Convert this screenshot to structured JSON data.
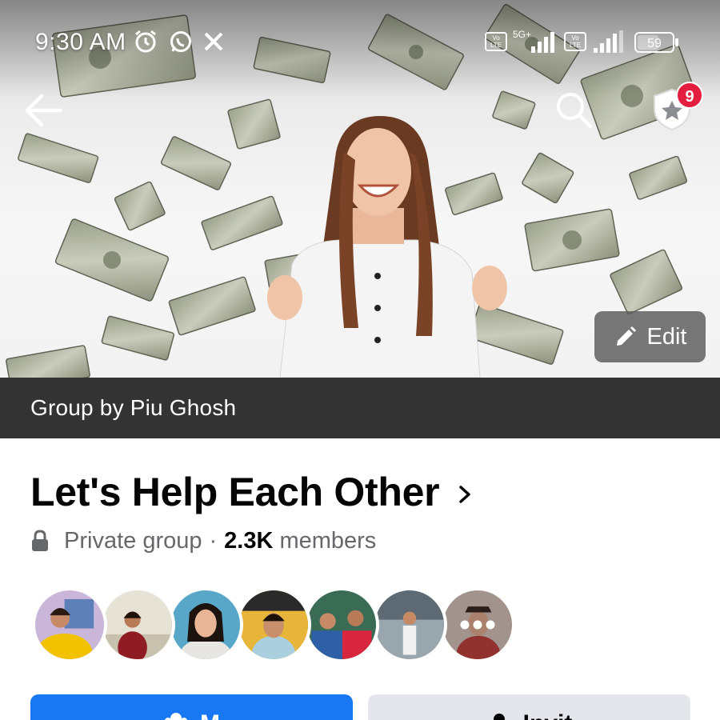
{
  "status_bar": {
    "time": "9:30 AM",
    "icons": [
      "alarm-icon",
      "whatsapp-icon",
      "close-icon",
      "volte-icon",
      "5g-icon",
      "signal-icon",
      "volte-icon",
      "signal-icon"
    ],
    "network": "5G+",
    "volte_label": "Vo LTE",
    "battery": "59"
  },
  "header": {
    "back_icon": "arrow-left-icon",
    "search_icon": "search-icon",
    "badge_icon": "shield-star-icon",
    "notification_count": "9"
  },
  "cover": {
    "edit_label": "Edit",
    "edit_icon": "pencil-icon",
    "owner_text": "Group by Piu Ghosh"
  },
  "group": {
    "name": "Let's Help Each Other",
    "privacy": "Private group",
    "separator": "·",
    "member_count": "2.3K",
    "member_suffix": "members",
    "lock_icon": "lock-icon",
    "chevron_icon": "chevron-right-icon"
  },
  "members": {
    "avatars": [
      "member-avatar-1",
      "member-avatar-2",
      "member-avatar-3",
      "member-avatar-4",
      "member-avatar-5",
      "member-avatar-6",
      "member-avatar-more"
    ]
  },
  "actions": {
    "primary_label": "M",
    "primary_icon": "group-icon",
    "secondary_label": "Invit",
    "secondary_icon": "add-person-icon"
  },
  "colors": {
    "accent": "#1877f2",
    "owner_bar": "#333333",
    "badge": "#e41e3f",
    "secondary_btn": "#e4e6eb",
    "muted_text": "#65676b"
  }
}
